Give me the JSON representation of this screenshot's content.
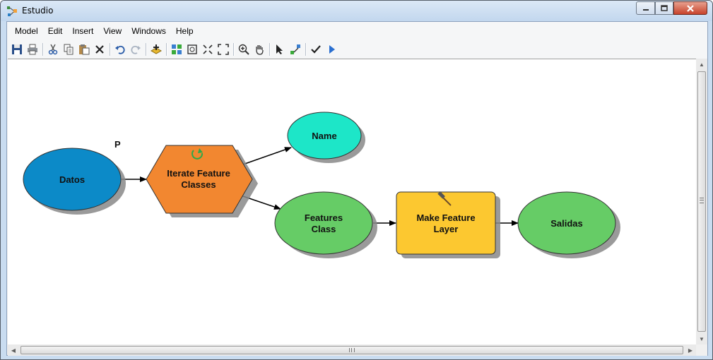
{
  "window": {
    "title": "Estudio",
    "app_icon": "model-builder-icon"
  },
  "menu": [
    "Model",
    "Edit",
    "Insert",
    "View",
    "Windows",
    "Help"
  ],
  "toolbar": {
    "buttons": [
      {
        "icon": "save-icon"
      },
      {
        "icon": "print-icon"
      },
      {
        "icon": "cut-icon"
      },
      {
        "icon": "copy-icon"
      },
      {
        "icon": "paste-icon"
      },
      {
        "icon": "delete-icon"
      },
      {
        "icon": "undo-icon"
      },
      {
        "icon": "redo-icon"
      },
      {
        "icon": "add-data-icon"
      },
      {
        "icon": "auto-layout-icon"
      },
      {
        "icon": "full-extent-icon"
      },
      {
        "icon": "fit-icon"
      },
      {
        "icon": "zoom-extent-icon"
      },
      {
        "icon": "zoom-in-icon"
      },
      {
        "icon": "pan-icon"
      },
      {
        "icon": "select-icon"
      },
      {
        "icon": "connect-icon"
      },
      {
        "icon": "validate-icon"
      },
      {
        "icon": "run-icon"
      }
    ]
  },
  "diagram": {
    "parameter_marker": "P",
    "nodes": {
      "datos": {
        "label": "Datos",
        "type": "input-data",
        "color": "#0c8ac8"
      },
      "iterate": {
        "label_line1": "Iterate Feature",
        "label_line2": "Classes",
        "type": "iterator",
        "color": "#f28730"
      },
      "name": {
        "label": "Name",
        "type": "output-value",
        "color": "#1de6c8"
      },
      "features": {
        "label_line1": "Features",
        "label_line2": "Class",
        "type": "output-data",
        "color": "#66cc66"
      },
      "make": {
        "label_line1": "Make Feature",
        "label_line2": "Layer",
        "type": "tool",
        "color": "#fcc830"
      },
      "salidas": {
        "label": "Salidas",
        "type": "output-data",
        "color": "#66cc66"
      }
    }
  }
}
